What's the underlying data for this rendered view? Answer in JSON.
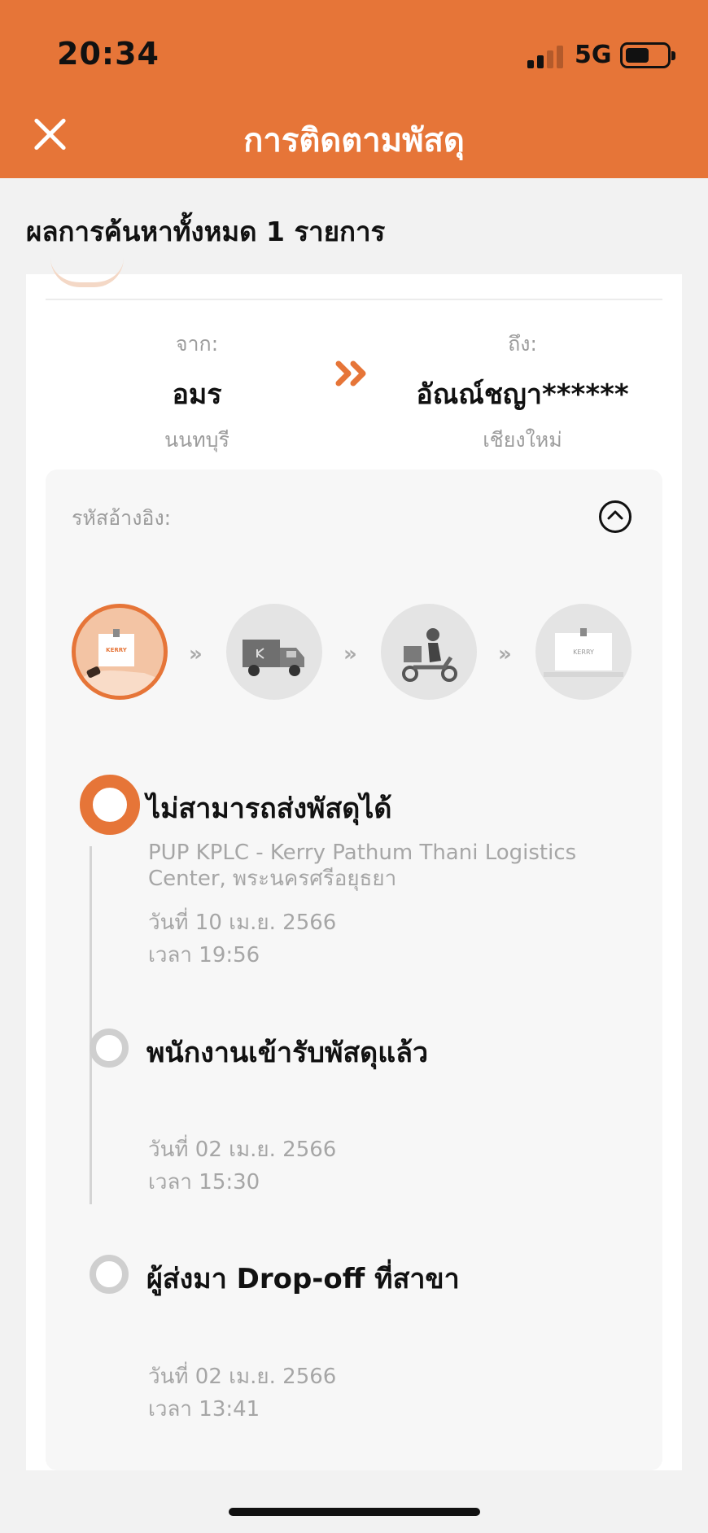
{
  "status_bar": {
    "time": "20:34",
    "network": "5G"
  },
  "header": {
    "title": "การติดตามพัสดุ"
  },
  "results": {
    "count_text": "ผลการค้นหาทั้งหมด 1 รายการ"
  },
  "shipment": {
    "from_label": "จาก:",
    "from_name": "อมร",
    "from_province": "นนทบุรี",
    "to_label": "ถึง:",
    "to_name": "อัณณ์ชญา******",
    "to_province": "เชียงใหม่",
    "reference_label": "รหัสอ้างอิง:"
  },
  "progress_steps": [
    {
      "icon": "parcel-handover-icon",
      "active": true
    },
    {
      "icon": "delivery-truck-icon",
      "active": false
    },
    {
      "icon": "motorcycle-courier-icon",
      "active": false
    },
    {
      "icon": "parcel-delivered-icon",
      "active": false
    }
  ],
  "brand": {
    "text": "KERRY",
    "accent": "#e67538"
  },
  "timeline": [
    {
      "title": "ไม่สามารถส่งพัสดุได้",
      "location": "PUP KPLC - Kerry Pathum Thani Logistics Center, พระนครศรีอยุธยา",
      "date": "วันที่ 10 เม.ย. 2566",
      "time": "เวลา 19:56",
      "active": true
    },
    {
      "title": "พนักงานเข้ารับพัสดุแล้ว",
      "location": "",
      "date": "วันที่ 02 เม.ย. 2566",
      "time": "เวลา 15:30",
      "active": false
    },
    {
      "title": "ผู้ส่งมา Drop-off ที่สาขา",
      "location": "",
      "date": "วันที่ 02 เม.ย. 2566",
      "time": "เวลา 13:41",
      "active": false
    }
  ],
  "colors": {
    "header": "#e67538",
    "background": "#f2f2f2",
    "muted_text": "#9c9c9c"
  }
}
